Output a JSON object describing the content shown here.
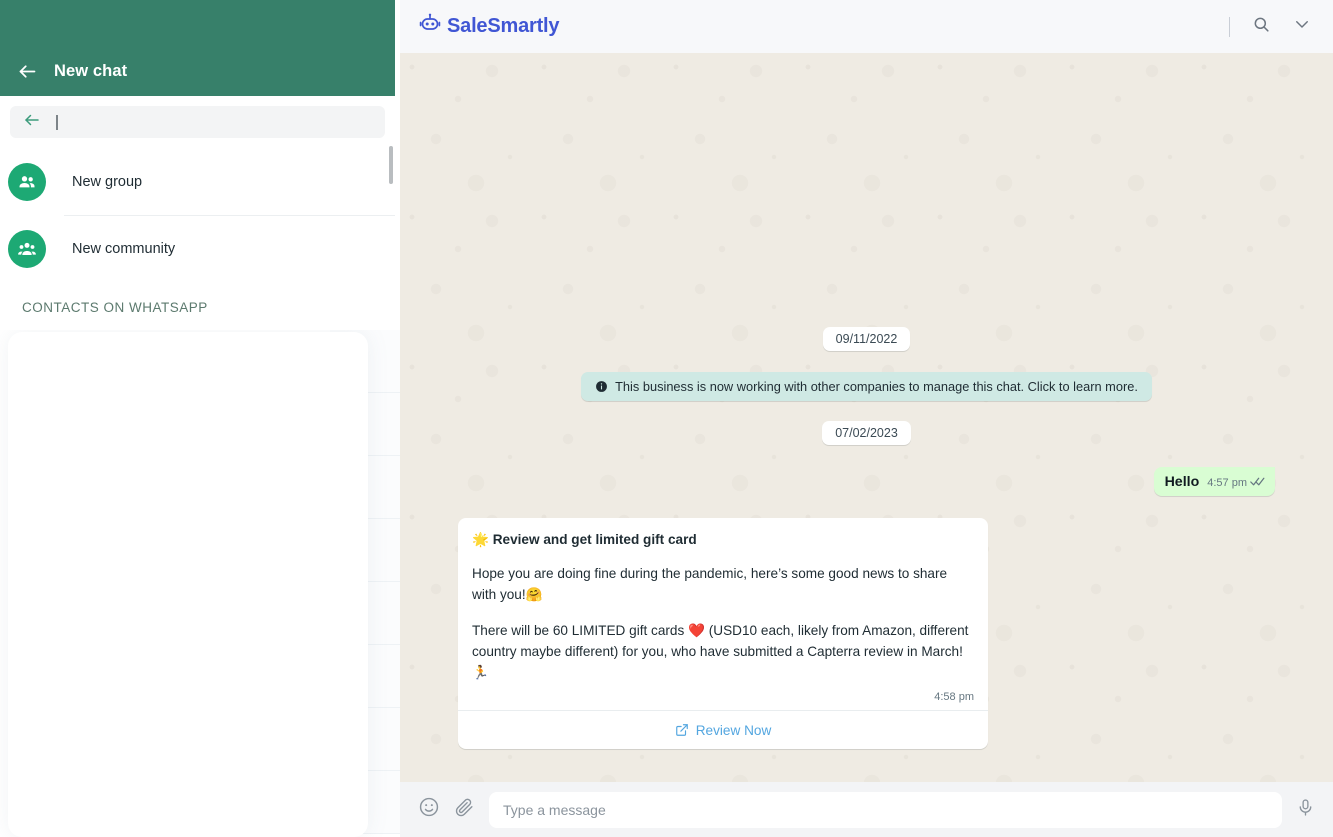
{
  "sidebar": {
    "header": {
      "title": "New chat",
      "back_icon": "arrow-left-icon"
    },
    "search": {
      "value": "",
      "placeholder": "",
      "back_icon": "arrow-left-icon"
    },
    "items": [
      {
        "label": "New group",
        "icon": "group-people-icon"
      },
      {
        "label": "New community",
        "icon": "community-people-icon"
      }
    ],
    "section_label": "CONTACTS ON WHATSAPP"
  },
  "topbar": {
    "brand": "SaleSmartly",
    "brand_icon": "robot-icon",
    "search_icon": "search-icon",
    "chevron_icon": "chevron-down-icon",
    "brand_color": "#4056d4"
  },
  "chat": {
    "messages": [
      {
        "type": "date",
        "text": "09/11/2022"
      },
      {
        "type": "info",
        "icon": "info-icon",
        "text": "This business is now working with other companies to manage this chat. Click to learn more."
      },
      {
        "type": "date",
        "text": "07/02/2023"
      },
      {
        "type": "outgoing",
        "text": "Hello",
        "time": "4:57 pm",
        "status_icon": "double-check-icon"
      }
    ],
    "card": {
      "emoji": "🌟",
      "title": "Review and get limited gift card",
      "paragraph_1": "Hope you are doing fine during the pandemic, here’s some good news to share with you!🤗",
      "paragraph_2": "There will be 60 LIMITED gift cards ❤️ (USD10 each, likely from Amazon, different country maybe different) for you, who have submitted a Capterra review in March! 🏃",
      "time": "4:58 pm",
      "action_label": "Review Now",
      "action_icon": "external-link-icon"
    }
  },
  "composer": {
    "emoji_icon": "emoji-smiley-icon",
    "attach_icon": "paperclip-icon",
    "placeholder": "Type a message",
    "value": "",
    "mic_icon": "microphone-icon"
  },
  "colors": {
    "whatsapp_green": "#37806a",
    "avatar_green": "#1da974",
    "outgoing_bubble": "#d9fdd3",
    "info_bubble": "#cfe9e4",
    "link_blue": "#53a6e0",
    "chat_bg": "#efebe3"
  }
}
